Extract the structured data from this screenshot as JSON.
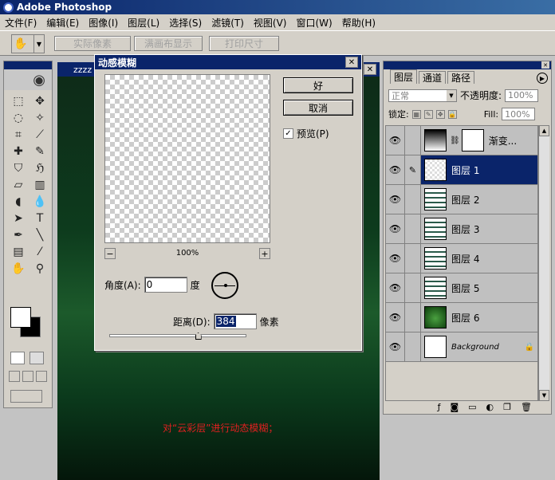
{
  "app": {
    "title": "Adobe Photoshop"
  },
  "menu": [
    "文件(F)",
    "编辑(E)",
    "图像(I)",
    "图层(L)",
    "选择(S)",
    "滤镜(T)",
    "视图(V)",
    "窗口(W)",
    "帮助(H)"
  ],
  "options": {
    "actual_pixels": "实际像素",
    "fit_screen": "满画布显示",
    "print_size": "打印尺寸"
  },
  "document": {
    "title": "zzzz",
    "caption": "对“云彩层”进行动态模糊；"
  },
  "dialog": {
    "title": "动感模糊",
    "ok": "好",
    "cancel": "取消",
    "preview_label": "预览(P)",
    "zoom": "100%",
    "angle_label": "角度(A):",
    "angle_value": "0",
    "angle_unit": "度",
    "distance_label": "距离(D):",
    "distance_value": "384",
    "distance_unit": "像素",
    "slider_fraction": 0.65
  },
  "layers_panel": {
    "tabs": [
      "图层",
      "通道",
      "路径"
    ],
    "blend_mode": "正常",
    "opacity_label": "不透明度:",
    "opacity_value": "100%",
    "lock_label": "锁定:",
    "fill_label": "Fill:",
    "fill_value": "100%",
    "layers": [
      {
        "name": "渐变...",
        "type": "adjust"
      },
      {
        "name": "图层 1",
        "type": "checker",
        "selected": true
      },
      {
        "name": "图层 2",
        "type": "mtn"
      },
      {
        "name": "图层 3",
        "type": "mtn"
      },
      {
        "name": "图层 4",
        "type": "mtn"
      },
      {
        "name": "图层 5",
        "type": "mtn"
      },
      {
        "name": "图层 6",
        "type": "green"
      },
      {
        "name": "Background",
        "type": "white"
      }
    ]
  }
}
